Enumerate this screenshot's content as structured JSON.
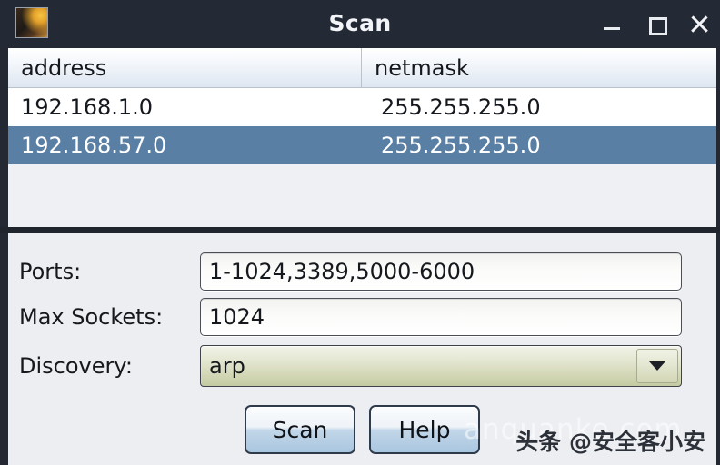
{
  "window": {
    "title": "Scan",
    "icon_name": "app-photo-icon",
    "controls": {
      "minimize": "–",
      "maximize": "□",
      "close": "✕"
    }
  },
  "table": {
    "columns": [
      "address",
      "netmask"
    ],
    "rows": [
      {
        "address": "192.168.1.0",
        "netmask": "255.255.255.0",
        "selected": false
      },
      {
        "address": "192.168.57.0",
        "netmask": "255.255.255.0",
        "selected": true
      }
    ],
    "selection_color": "#5a7fa5"
  },
  "form": {
    "ports": {
      "label": "Ports:",
      "value": "1-1024,3389,5000-6000",
      "placeholder": ""
    },
    "max_sockets": {
      "label": "Max Sockets:",
      "value": "1024",
      "placeholder": ""
    },
    "discovery": {
      "label": "Discovery:",
      "value": "arp",
      "options": [
        "arp"
      ]
    }
  },
  "buttons": {
    "scan": "Scan",
    "help": "Help"
  },
  "watermarks": {
    "site": "anquanke.com",
    "author": "头条 @安全客小安"
  }
}
